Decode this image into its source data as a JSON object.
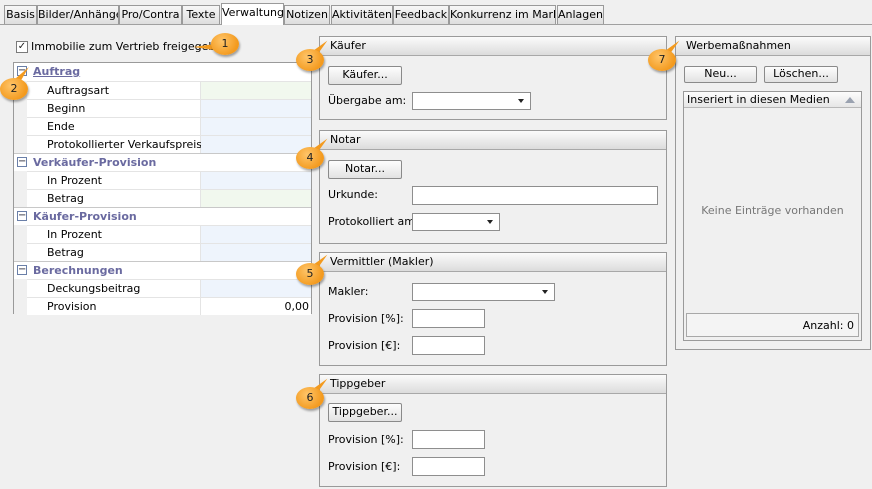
{
  "tabs": [
    "Basis",
    "Bilder/Anhänge",
    "Pro/Contra",
    "Texte",
    "Verwaltung",
    "Notizen",
    "Aktivitäten",
    "Feedback",
    "Konkurrenz im Markt",
    "Anlagen"
  ],
  "active_tab": "Verwaltung",
  "checkbox": {
    "label": "Immobilie zum Vertrieb freigegeben",
    "checked": true,
    "mark": "✓"
  },
  "grid": {
    "toggle": "−",
    "categories": [
      {
        "label": "Auftrag",
        "rows": [
          {
            "label": "Auftragsart",
            "value": ""
          },
          {
            "label": "Beginn",
            "value": ""
          },
          {
            "label": "Ende",
            "value": ""
          },
          {
            "label": "Protokollierter Verkaufspreis",
            "value": ""
          }
        ]
      },
      {
        "label": "Verkäufer-Provision",
        "rows": [
          {
            "label": "In Prozent",
            "value": ""
          },
          {
            "label": "Betrag",
            "value": ""
          }
        ]
      },
      {
        "label": "Käufer-Provision",
        "rows": [
          {
            "label": "In Prozent",
            "value": ""
          },
          {
            "label": "Betrag",
            "value": ""
          }
        ]
      },
      {
        "label": "Berechnungen",
        "rows": [
          {
            "label": "Deckungsbeitrag",
            "value": ""
          },
          {
            "label": "Provision",
            "value": "0,00"
          }
        ]
      }
    ]
  },
  "kaeufer": {
    "title": "Käufer",
    "button": "Käufer...",
    "uebergabe_label": "Übergabe am:",
    "uebergabe_value": ""
  },
  "notar": {
    "title": "Notar",
    "button": "Notar...",
    "urkunde_label": "Urkunde:",
    "urkunde_value": "",
    "protokolliert_label": "Protokolliert am:",
    "protokolliert_value": ""
  },
  "vermittler": {
    "title": "Vermittler (Makler)",
    "makler_label": "Makler:",
    "makler_value": "",
    "provision_pct_label": "Provision [%]:",
    "provision_pct_value": "",
    "provision_eur_label": "Provision [€]:",
    "provision_eur_value": ""
  },
  "tippgeber": {
    "title": "Tippgeber",
    "button": "Tippgeber...",
    "provision_pct_label": "Provision [%]:",
    "provision_pct_value": "",
    "provision_eur_label": "Provision [€]:",
    "provision_eur_value": ""
  },
  "werbemassnahmen": {
    "title": "Werbemaßnahmen",
    "new_button": "Neu...",
    "delete_button": "Löschen...",
    "column": "Inseriert in diesen Medien",
    "empty": "Keine Einträge vorhanden",
    "count": "Anzahl: 0"
  },
  "callouts": [
    "1",
    "2",
    "3",
    "4",
    "5",
    "6",
    "7"
  ],
  "colors": {
    "accent": "#f39a1e",
    "category_text": "#6a6aa0",
    "value_blue": "#eef4fc",
    "value_green": "#f1f8ee"
  }
}
